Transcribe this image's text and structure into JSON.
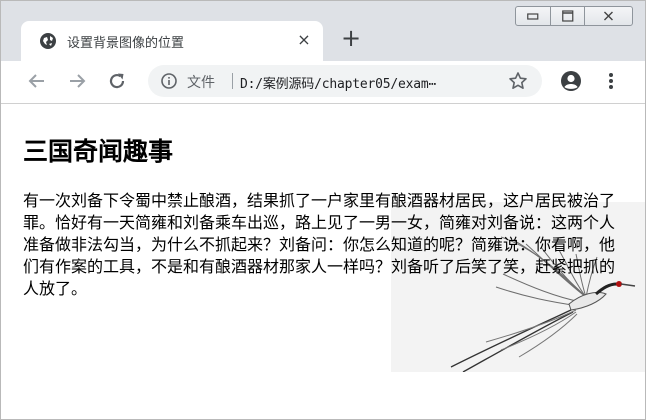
{
  "browser": {
    "tab_title": "设置背景图像的位置",
    "tab_close": "×",
    "new_tab": "+",
    "omnibox_label": "文件",
    "url": "D:/案例源码/chapter05/exam⋯"
  },
  "page": {
    "heading": "三国奇闻趣事",
    "paragraph": "有一次刘备下令蜀中禁止酿酒，结果抓了一户家里有酿酒器材居民，这户居民被治了罪。恰好有一天简雍和刘备乘车出巡，路上见了一男一女，简雍对刘备说：这两个人准备做非法勾当，为什么不抓起来？刘备问：你怎么知道的呢？简雍说：你看啊，他们有作案的工具，不是和有酿酒器材那家人一样吗？刘备听了后笑了笑，赶紧把抓的人放了。"
  },
  "icons": {
    "favicon": "globe-icon",
    "back": "arrow-left-icon",
    "forward": "arrow-right-icon",
    "reload": "reload-icon",
    "info": "info-icon",
    "star": "star-icon",
    "account": "account-icon",
    "menu": "kebab-menu-icon",
    "minimize": "minimize-icon",
    "maximize": "maximize-icon",
    "close": "close-icon"
  },
  "colors": {
    "tabstrip": "#dee1e6",
    "omnibox": "#f1f3f4",
    "icon": "#5f6368"
  }
}
